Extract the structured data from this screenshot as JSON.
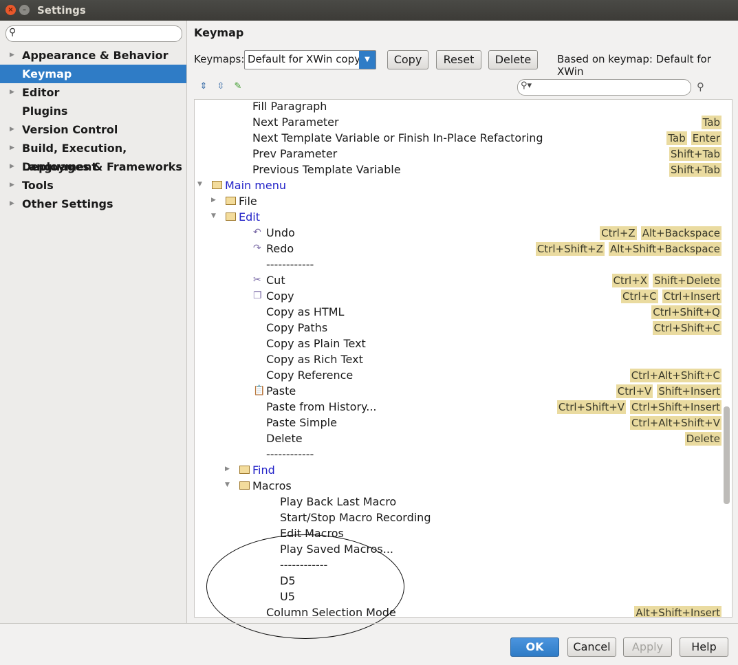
{
  "window": {
    "title": "Settings"
  },
  "sidebar": {
    "search_placeholder": "",
    "items": [
      {
        "label": "Appearance & Behavior",
        "has_arrow": true,
        "selected": false
      },
      {
        "label": "Keymap",
        "has_arrow": false,
        "selected": true
      },
      {
        "label": "Editor",
        "has_arrow": true,
        "selected": false
      },
      {
        "label": "Plugins",
        "has_arrow": false,
        "selected": false
      },
      {
        "label": "Version Control",
        "has_arrow": true,
        "selected": false
      },
      {
        "label": "Build, Execution, Deployment",
        "has_arrow": true,
        "selected": false
      },
      {
        "label": "Languages & Frameworks",
        "has_arrow": true,
        "selected": false
      },
      {
        "label": "Tools",
        "has_arrow": true,
        "selected": false
      },
      {
        "label": "Other Settings",
        "has_arrow": true,
        "selected": false
      }
    ]
  },
  "panel": {
    "title": "Keymap",
    "keymaps_label": "Keymaps:",
    "keymap_selected": "Default for XWin copy",
    "copy_label": "Copy",
    "reset_label": "Reset",
    "delete_label": "Delete",
    "based_on": "Based on keymap: Default for XWin"
  },
  "tree": [
    {
      "text": "Fill Paragraph",
      "indent": 3,
      "shortcuts": []
    },
    {
      "text": "Next Parameter",
      "indent": 3,
      "shortcuts": [
        "Tab"
      ]
    },
    {
      "text": "Next Template Variable or Finish In-Place Refactoring",
      "indent": 3,
      "shortcuts": [
        "Tab",
        "Enter"
      ]
    },
    {
      "text": "Prev Parameter",
      "indent": 3,
      "shortcuts": [
        "Shift+Tab"
      ]
    },
    {
      "text": "Previous Template Variable",
      "indent": 3,
      "shortcuts": [
        "Shift+Tab"
      ]
    },
    {
      "text": "Main menu",
      "indent": 1,
      "toggle": "open",
      "folder": true,
      "blue": true,
      "shortcuts": []
    },
    {
      "text": "File",
      "indent": 2,
      "toggle": "closed",
      "folder": true,
      "shortcuts": []
    },
    {
      "text": "Edit",
      "indent": 2,
      "toggle": "open",
      "folder": true,
      "blue": true,
      "shortcuts": []
    },
    {
      "text": "Undo",
      "indent": 4,
      "icon": "undo",
      "shortcuts": [
        "Ctrl+Z",
        "Alt+Backspace"
      ]
    },
    {
      "text": "Redo",
      "indent": 4,
      "icon": "redo",
      "shortcuts": [
        "Ctrl+Shift+Z",
        "Alt+Shift+Backspace"
      ]
    },
    {
      "text": "------------",
      "indent": 4,
      "shortcuts": []
    },
    {
      "text": "Cut",
      "indent": 4,
      "icon": "cut",
      "shortcuts": [
        "Ctrl+X",
        "Shift+Delete"
      ]
    },
    {
      "text": "Copy",
      "indent": 4,
      "icon": "copy",
      "shortcuts": [
        "Ctrl+C",
        "Ctrl+Insert"
      ]
    },
    {
      "text": "Copy as HTML",
      "indent": 4,
      "shortcuts": [
        "Ctrl+Shift+Q"
      ]
    },
    {
      "text": "Copy Paths",
      "indent": 4,
      "shortcuts": [
        "Ctrl+Shift+C"
      ]
    },
    {
      "text": "Copy as Plain Text",
      "indent": 4,
      "shortcuts": []
    },
    {
      "text": "Copy as Rich Text",
      "indent": 4,
      "shortcuts": []
    },
    {
      "text": "Copy Reference",
      "indent": 4,
      "shortcuts": [
        "Ctrl+Alt+Shift+C"
      ]
    },
    {
      "text": "Paste",
      "indent": 4,
      "icon": "paste",
      "shortcuts": [
        "Ctrl+V",
        "Shift+Insert"
      ]
    },
    {
      "text": "Paste from History...",
      "indent": 4,
      "shortcuts": [
        "Ctrl+Shift+V",
        "Ctrl+Shift+Insert"
      ]
    },
    {
      "text": "Paste Simple",
      "indent": 4,
      "shortcuts": [
        "Ctrl+Alt+Shift+V"
      ]
    },
    {
      "text": "Delete",
      "indent": 4,
      "shortcuts": [
        "Delete"
      ]
    },
    {
      "text": "------------",
      "indent": 4,
      "shortcuts": []
    },
    {
      "text": "Find",
      "indent": 3,
      "toggle": "closed",
      "folder": true,
      "blue": true,
      "shortcuts": []
    },
    {
      "text": "Macros",
      "indent": 3,
      "toggle": "open",
      "folder": true,
      "shortcuts": []
    },
    {
      "text": "Play Back Last Macro",
      "indent": 5,
      "shortcuts": []
    },
    {
      "text": "Start/Stop Macro Recording",
      "indent": 5,
      "shortcuts": []
    },
    {
      "text": "Edit Macros",
      "indent": 5,
      "shortcuts": []
    },
    {
      "text": "Play Saved Macros...",
      "indent": 5,
      "shortcuts": []
    },
    {
      "text": "------------",
      "indent": 5,
      "shortcuts": []
    },
    {
      "text": "D5",
      "indent": 5,
      "shortcuts": []
    },
    {
      "text": "U5",
      "indent": 5,
      "shortcuts": []
    },
    {
      "text": "Column Selection Mode",
      "indent": 4,
      "shortcuts": [
        "Alt+Shift+Insert"
      ]
    }
  ],
  "footer": {
    "ok": "OK",
    "cancel": "Cancel",
    "apply": "Apply",
    "help": "Help"
  },
  "colors": {
    "accent": "#2f7cc6",
    "shortcut_bg": "#eadba0",
    "link_blue": "#2323c8"
  }
}
